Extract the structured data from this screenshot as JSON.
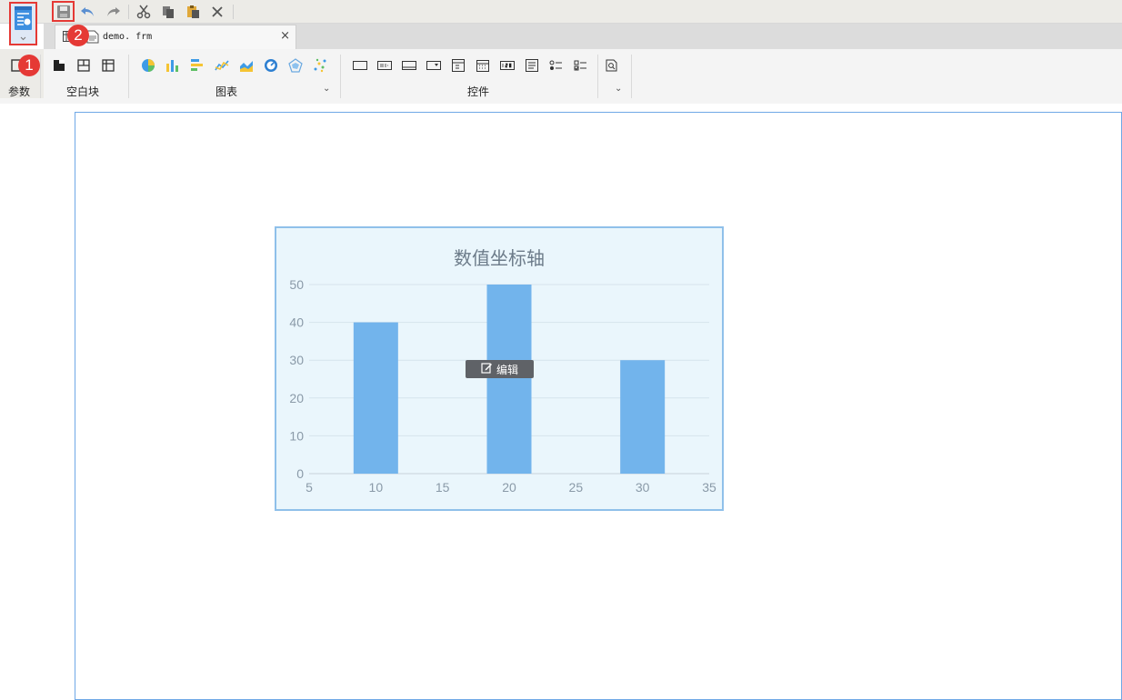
{
  "toolbar": {
    "badge_app": "1",
    "badge_save": "2"
  },
  "document_tab": {
    "filename": "demo. frm",
    "close": "×"
  },
  "ribbon": {
    "groups": {
      "params": "参数",
      "blank_block": "空白块",
      "charts": "图表",
      "controls": "控件"
    },
    "expand_glyph": "⌄"
  },
  "edit_chip": {
    "label": "编辑"
  },
  "chart_data": {
    "type": "bar",
    "title": "数值坐标轴",
    "x_ticks": [
      5,
      10,
      15,
      20,
      25,
      30,
      35
    ],
    "y_ticks": [
      0,
      10,
      20,
      30,
      40,
      50
    ],
    "xlim": [
      5,
      35
    ],
    "ylim": [
      0,
      50
    ],
    "x": [
      10,
      20,
      30
    ],
    "values": [
      40,
      50,
      30
    ],
    "grid": true,
    "legend": "none",
    "bar_color": "#72b4ec"
  },
  "colors": {
    "accent": "#4a90d9",
    "highlight": "#e53935",
    "canvas_border": "#6fa8e6",
    "chart_bg": "#eaf6fc"
  }
}
